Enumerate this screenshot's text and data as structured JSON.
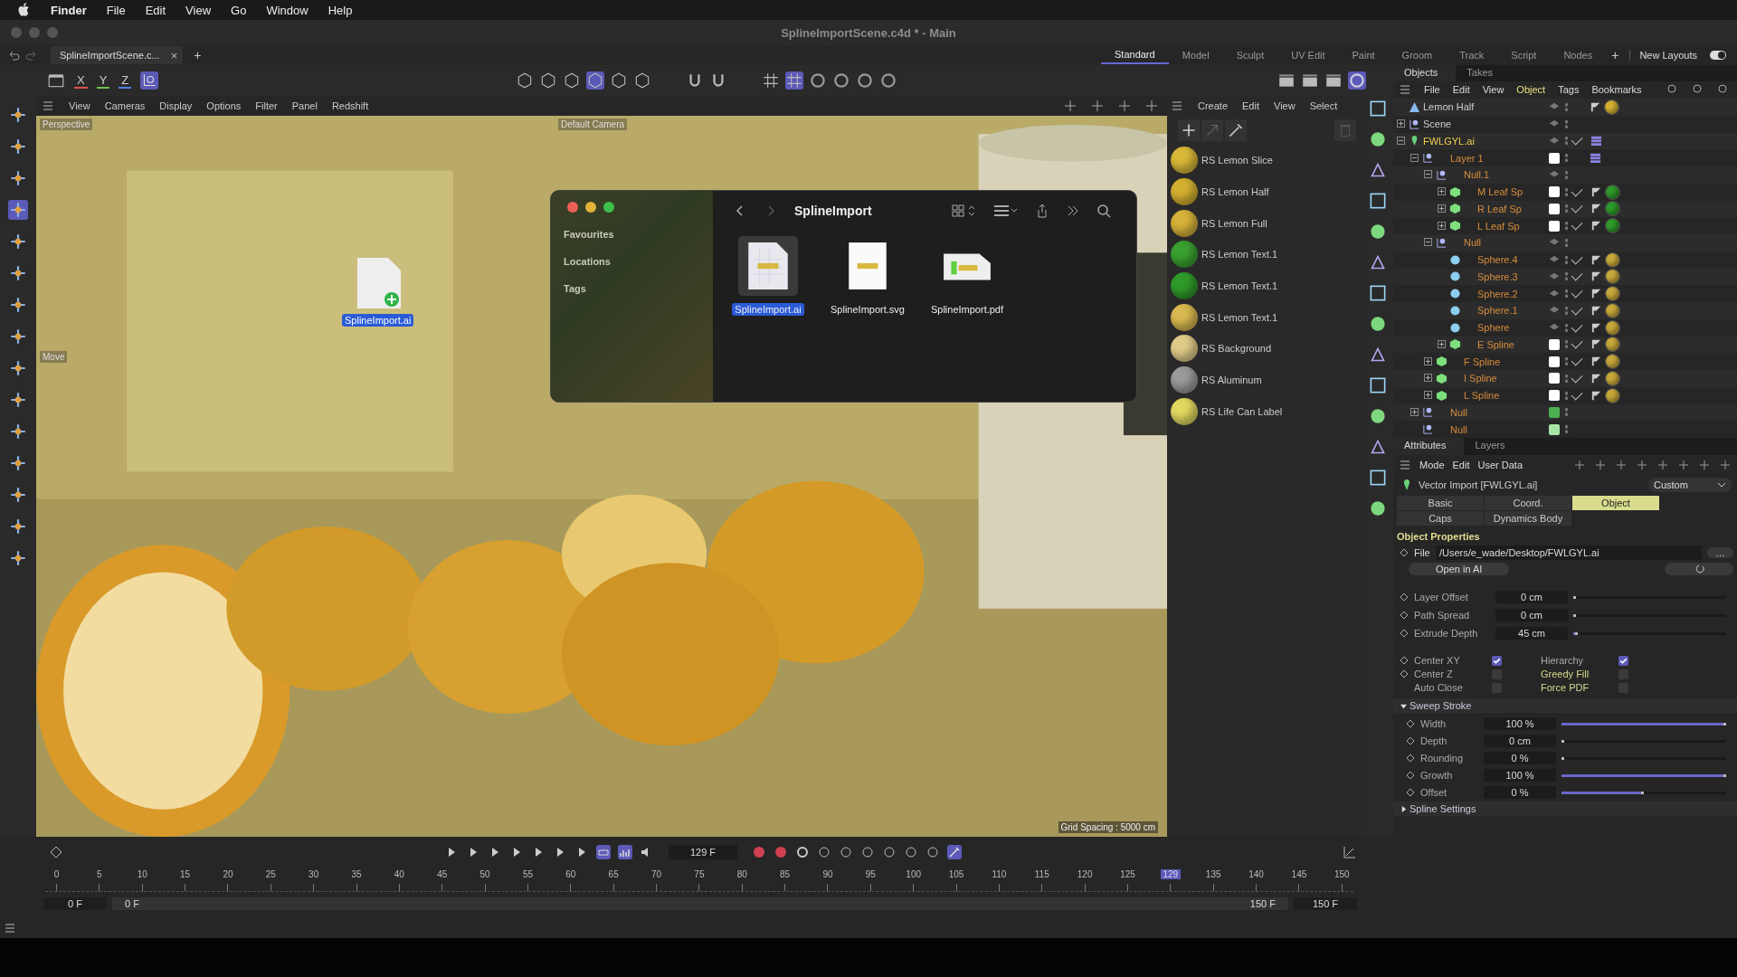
{
  "menubar": {
    "app": "Finder",
    "items": [
      "File",
      "Edit",
      "View",
      "Go",
      "Window",
      "Help"
    ]
  },
  "window": {
    "title": "SplineImportScene.c4d * - Main"
  },
  "doc_tab": {
    "label": "SplineImportScene.c...",
    "close": "×",
    "add": "+"
  },
  "layouts": [
    {
      "label": "Standard",
      "selected": true
    },
    {
      "label": "Model",
      "selected": false
    },
    {
      "label": "Sculpt",
      "selected": false
    },
    {
      "label": "UV Edit",
      "selected": false
    },
    {
      "label": "Paint",
      "selected": false
    },
    {
      "label": "Groom",
      "selected": false
    },
    {
      "label": "Track",
      "selected": false
    },
    {
      "label": "Script",
      "selected": false
    },
    {
      "label": "Nodes",
      "selected": false
    }
  ],
  "layouts_add": "+",
  "new_layouts": {
    "label": "New Layouts",
    "on": true
  },
  "axis_buttons": [
    {
      "label": "X",
      "color": "#e05050"
    },
    {
      "label": "Y",
      "color": "#70c050"
    },
    {
      "label": "Z",
      "color": "#5080e0"
    }
  ],
  "viewport": {
    "menu": [
      "View",
      "Cameras",
      "Display",
      "Options",
      "Filter",
      "Panel",
      "Redshift"
    ],
    "label": "Perspective",
    "camera": "Default Camera",
    "tool": "Move",
    "grid": "Grid Spacing : 5000 cm"
  },
  "dragged_file": {
    "name": "SplineImport.ai"
  },
  "finder": {
    "title": "SplineImport",
    "sidebar": [
      "Favourites",
      "Locations",
      "Tags"
    ],
    "files": [
      {
        "name": "SplineImport.ai",
        "kind": "ai",
        "selected": true
      },
      {
        "name": "SplineImport.svg",
        "kind": "svg",
        "selected": false
      },
      {
        "name": "SplineImport.pdf",
        "kind": "pdf",
        "selected": false
      }
    ]
  },
  "materials": {
    "menu": [
      "Create",
      "Edit",
      "View",
      "Select"
    ],
    "items": [
      {
        "name": "RS Lemon Slice",
        "color": "#d8b838"
      },
      {
        "name": "RS Lemon Half",
        "color": "#d4b030"
      },
      {
        "name": "RS Lemon Full",
        "color": "#d6b23a"
      },
      {
        "name": "RS Lemon Text.1",
        "color": "#3aa030"
      },
      {
        "name": "RS Lemon Text.1",
        "color": "#2f9a2a"
      },
      {
        "name": "RS Lemon Text.1",
        "color": "#d8b850"
      },
      {
        "name": "RS Background",
        "color": "#e0cc88"
      },
      {
        "name": "RS Aluminum",
        "color": "#9a9a9a"
      },
      {
        "name": "RS Life Can Label",
        "color": "#e0d860"
      }
    ]
  },
  "objects": {
    "tabs": [
      {
        "label": "Objects",
        "selected": true
      },
      {
        "label": "Takes",
        "selected": false
      }
    ],
    "menu": [
      {
        "label": "File",
        "selected": false
      },
      {
        "label": "Edit",
        "selected": false
      },
      {
        "label": "View",
        "selected": false
      },
      {
        "label": "Object",
        "selected": true
      },
      {
        "label": "Tags",
        "selected": false
      },
      {
        "label": "Bookmarks",
        "selected": false
      }
    ],
    "tree": [
      {
        "name": "Lemon Half",
        "kind": "shape",
        "selected": false,
        "in_layer": false,
        "material": {
          "color": "#d4b030"
        }
      },
      {
        "name": "Scene",
        "kind": "null",
        "selected": false,
        "in_layer": false,
        "expanded": false
      },
      {
        "name": "FWLGYL.ai",
        "kind": "vector",
        "selected": true,
        "in_layer": false,
        "expanded": true,
        "checked": true,
        "children": [
          {
            "name": "Layer 1",
            "kind": "null",
            "selected": false,
            "in_layer": true,
            "expanded": true,
            "color": "#ffffff",
            "children": [
              {
                "name": "Null.1",
                "kind": "null",
                "selected": false,
                "in_layer": true,
                "expanded": true,
                "children": [
                  {
                    "name": "M Leaf Sp",
                    "kind": "extrude",
                    "selected": false,
                    "in_layer": true,
                    "expanded": false,
                    "color": "#ffffff",
                    "checked": true,
                    "material": {
                      "color": "#2e9a2a"
                    }
                  },
                  {
                    "name": "R Leaf Sp",
                    "kind": "extrude",
                    "selected": false,
                    "in_layer": true,
                    "expanded": false,
                    "color": "#ffffff",
                    "checked": true,
                    "material": {
                      "color": "#2e9a2a"
                    }
                  },
                  {
                    "name": "L Leaf Sp",
                    "kind": "extrude",
                    "selected": false,
                    "in_layer": true,
                    "expanded": false,
                    "color": "#ffffff",
                    "checked": true,
                    "material": {
                      "color": "#2e9a2a"
                    }
                  }
                ]
              },
              {
                "name": "Null",
                "kind": "null",
                "selected": false,
                "in_layer": true,
                "expanded": true,
                "children": [
                  {
                    "name": "Sphere.4",
                    "kind": "sphere",
                    "selected": false,
                    "in_layer": true,
                    "checked": true,
                    "material": {
                      "color": "#c8a83a"
                    }
                  },
                  {
                    "name": "Sphere.3",
                    "kind": "sphere",
                    "selected": false,
                    "in_layer": true,
                    "checked": true,
                    "material": {
                      "color": "#c8a83a"
                    }
                  },
                  {
                    "name": "Sphere.2",
                    "kind": "sphere",
                    "selected": false,
                    "in_layer": true,
                    "checked": true,
                    "material": {
                      "color": "#c8a83a"
                    }
                  },
                  {
                    "name": "Sphere.1",
                    "kind": "sphere",
                    "selected": false,
                    "in_layer": true,
                    "checked": true,
                    "material": {
                      "color": "#c8a83a"
                    }
                  },
                  {
                    "name": "Sphere",
                    "kind": "sphere",
                    "selected": false,
                    "in_layer": true,
                    "checked": true,
                    "material": {
                      "color": "#c8a83a"
                    }
                  },
                  {
                    "name": "E Spline",
                    "kind": "extrude",
                    "selected": false,
                    "in_layer": true,
                    "expanded": false,
                    "color": "#ffffff",
                    "checked": true,
                    "material": {
                      "color": "#c8a83a"
                    }
                  }
                ]
              },
              {
                "name": "F Spline",
                "kind": "extrude",
                "selected": false,
                "in_layer": true,
                "expanded": false,
                "color": "#ffffff",
                "checked": true,
                "material": {
                  "color": "#c8a83a"
                }
              },
              {
                "name": "I Spline",
                "kind": "extrude",
                "selected": false,
                "in_layer": true,
                "expanded": false,
                "color": "#ffffff",
                "checked": true,
                "material": {
                  "color": "#c8a83a"
                }
              },
              {
                "name": "L Spline",
                "kind": "extrude",
                "selected": false,
                "in_layer": true,
                "expanded": false,
                "color": "#ffffff",
                "checked": true,
                "material": {
                  "color": "#c8a83a"
                }
              }
            ]
          },
          {
            "name": "Null",
            "kind": "null",
            "selected": false,
            "in_layer": true,
            "expanded": false,
            "color": "#4caf50"
          },
          {
            "name": "Null",
            "kind": "null",
            "selected": false,
            "in_layer": true,
            "color": "#a8e6a8"
          }
        ]
      }
    ]
  },
  "attributes": {
    "tabs": [
      {
        "label": "Attributes",
        "selected": true
      },
      {
        "label": "Layers",
        "selected": false
      }
    ],
    "menu": [
      "Mode",
      "Edit",
      "User Data"
    ],
    "title": "Vector Import [FWLGYL.ai]",
    "preset": "Custom",
    "pages": [
      {
        "label": "Basic",
        "selected": false
      },
      {
        "label": "Coord.",
        "selected": false
      },
      {
        "label": "Object",
        "selected": true
      },
      {
        "label": "Caps",
        "selected": false
      },
      {
        "label": "Dynamics Body",
        "selected": false
      }
    ],
    "section": "Object Properties",
    "file": {
      "label": "File",
      "value": "/Users/e_wade/Desktop/FWLGYL.ai",
      "browse": "..."
    },
    "open_button": "Open in AI",
    "params": [
      {
        "label": "Layer Offset",
        "value": "0 cm",
        "level": 0
      },
      {
        "label": "Path Spread",
        "value": "0 cm",
        "level": 0
      },
      {
        "label": "Extrude Depth",
        "value": "45 cm",
        "level": 0.03
      }
    ],
    "checks": [
      {
        "label": "Center XY",
        "checked": true,
        "keyframe": true,
        "highlight": false
      },
      {
        "label": "Hierarchy",
        "checked": true,
        "keyframe": false,
        "highlight": false
      },
      {
        "label": "Center Z",
        "checked": false,
        "keyframe": true,
        "highlight": false
      },
      {
        "label": "Greedy Fill",
        "checked": false,
        "keyframe": false,
        "highlight": true
      },
      {
        "label": "Auto Close",
        "checked": false,
        "keyframe": false,
        "highlight": false
      },
      {
        "label": "Force PDF",
        "checked": false,
        "keyframe": false,
        "highlight": true
      }
    ],
    "groups": [
      {
        "label": "Sweep Stroke",
        "expanded": true,
        "params": [
          {
            "label": "Width",
            "value": "100 %",
            "level": 1
          },
          {
            "label": "Depth",
            "value": "0 cm",
            "level": 0
          },
          {
            "label": "Rounding",
            "value": "0 %",
            "level": 0
          },
          {
            "label": "Growth",
            "value": "100 %",
            "level": 1
          },
          {
            "label": "Offset",
            "value": "0 %",
            "level": 0.5
          }
        ]
      },
      {
        "label": "Spline Settings",
        "expanded": false
      }
    ]
  },
  "timeline": {
    "current": "129 F",
    "ticks": [
      {
        "label": "0",
        "kind": "frame"
      },
      {
        "label": "5",
        "kind": "frame"
      },
      {
        "label": "10",
        "kind": "frame"
      },
      {
        "label": "15",
        "kind": "frame"
      },
      {
        "label": "20",
        "kind": "frame"
      },
      {
        "label": "25",
        "kind": "frame"
      },
      {
        "label": "30",
        "kind": "frame"
      },
      {
        "label": "35",
        "kind": "frame"
      },
      {
        "label": "40",
        "kind": "frame"
      },
      {
        "label": "45",
        "kind": "frame"
      },
      {
        "label": "50",
        "kind": "frame"
      },
      {
        "label": "55",
        "kind": "frame"
      },
      {
        "label": "60",
        "kind": "frame"
      },
      {
        "label": "65",
        "kind": "frame"
      },
      {
        "label": "70",
        "kind": "frame"
      },
      {
        "label": "75",
        "kind": "frame"
      },
      {
        "label": "80",
        "kind": "frame"
      },
      {
        "label": "85",
        "kind": "frame"
      },
      {
        "label": "90",
        "kind": "frame"
      },
      {
        "label": "95",
        "kind": "frame"
      },
      {
        "label": "100",
        "kind": "frame"
      },
      {
        "label": "105",
        "kind": "frame"
      },
      {
        "label": "110",
        "kind": "frame"
      },
      {
        "label": "115",
        "kind": "frame"
      },
      {
        "label": "120",
        "kind": "frame"
      },
      {
        "label": "125",
        "kind": "frame"
      },
      {
        "label": "129",
        "kind": "playhead"
      },
      {
        "label": "135",
        "kind": "frame"
      },
      {
        "label": "140",
        "kind": "frame"
      },
      {
        "label": "145",
        "kind": "frame"
      },
      {
        "label": "150",
        "kind": "frame"
      }
    ],
    "start": "0 F",
    "range_start": "0 F",
    "range_end": "150 F",
    "end": "150 F"
  }
}
